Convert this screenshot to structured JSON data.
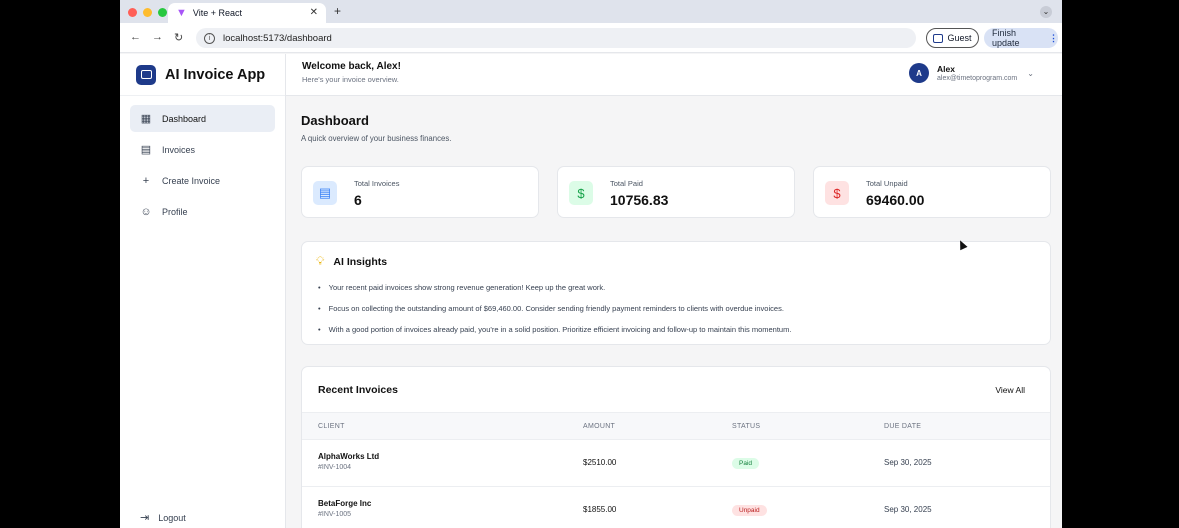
{
  "browser": {
    "tab_title": "Vite + React",
    "url": "localhost:5173/dashboard",
    "guest_label": "Guest",
    "finish_update_label": "Finish update"
  },
  "sidebar": {
    "app_name": "AI Invoice App",
    "items": [
      {
        "label": "Dashboard",
        "icon": "grid-icon",
        "active": true
      },
      {
        "label": "Invoices",
        "icon": "document-icon",
        "active": false
      },
      {
        "label": "Create Invoice",
        "icon": "plus-icon",
        "active": false
      },
      {
        "label": "Profile",
        "icon": "user-icon",
        "active": false
      }
    ],
    "logout_label": "Logout"
  },
  "header": {
    "welcome": "Welcome back, Alex!",
    "subtitle": "Here's your invoice overview.",
    "user_initial": "A",
    "user_name": "Alex",
    "user_email": "alex@timetoprogram.com"
  },
  "page": {
    "title": "Dashboard",
    "subtitle": "A quick overview of your business finances."
  },
  "stats": [
    {
      "label": "Total Invoices",
      "value": "6",
      "icon": "document-icon",
      "color": "#3b82f6",
      "bg": "#dbeafe"
    },
    {
      "label": "Total Paid",
      "value": "10756.83",
      "icon": "dollar-icon",
      "color": "#16a34a",
      "bg": "#dcfce7"
    },
    {
      "label": "Total Unpaid",
      "value": "69460.00",
      "icon": "dollar-icon",
      "color": "#dc2626",
      "bg": "#fee2e2"
    }
  ],
  "insights": {
    "title": "AI Insights",
    "items": [
      "Your recent paid invoices show strong revenue generation! Keep up the great work.",
      "Focus on collecting the outstanding amount of $69,460.00. Consider sending friendly payment reminders to clients with overdue invoices.",
      "With a good portion of invoices already paid, you're in a solid position. Prioritize efficient invoicing and follow-up to maintain this momentum."
    ]
  },
  "recent": {
    "title": "Recent Invoices",
    "view_all": "View All",
    "columns": [
      "CLIENT",
      "AMOUNT",
      "STATUS",
      "DUE DATE"
    ],
    "rows": [
      {
        "client": "AlphaWorks Ltd",
        "invoice": "#INV-1004",
        "amount": "$2510.00",
        "status": "Paid",
        "due": "Sep 30, 2025"
      },
      {
        "client": "BetaForge Inc",
        "invoice": "#INV-1005",
        "amount": "$1855.00",
        "status": "Unpaid",
        "due": "Sep 30, 2025"
      }
    ]
  },
  "colors": {
    "brand": "#1e3a8a",
    "paid_bg": "#dcfce7",
    "paid_text": "#15803d",
    "unpaid_bg": "#fee2e2",
    "unpaid_text": "#b91c1c"
  }
}
